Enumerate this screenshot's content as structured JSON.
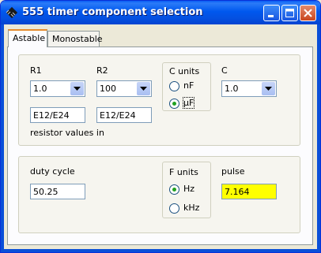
{
  "window": {
    "title": "555 timer component selection",
    "icon": "chip-icon",
    "controls": [
      "minimize-icon",
      "maximize-icon",
      "close-icon"
    ],
    "title_bar_color": "#0058ee"
  },
  "tabs": [
    {
      "label": "Astable",
      "active": true
    },
    {
      "label": "Monostable",
      "active": false
    }
  ],
  "component_group": {
    "r1": {
      "label": "R1",
      "value": "1.0",
      "series": "E12/E24"
    },
    "r2": {
      "label": "R2",
      "value": "100",
      "series": "E12/E24"
    },
    "resistor_caption": "resistor values in",
    "c_units": {
      "label": "C units",
      "options": [
        {
          "label": "nF",
          "checked": false
        },
        {
          "label": "µF",
          "checked": true
        }
      ]
    },
    "c": {
      "label": "C",
      "value": "1.0"
    }
  },
  "output_group": {
    "duty_cycle": {
      "label": "duty cycle",
      "value": "50.25"
    },
    "f_units": {
      "label": "F units",
      "options": [
        {
          "label": "Hz",
          "checked": true
        },
        {
          "label": "kHz",
          "checked": false
        }
      ]
    },
    "pulse": {
      "label": "pulse",
      "value": "7.164",
      "highlight_color": "#ffff00"
    }
  }
}
